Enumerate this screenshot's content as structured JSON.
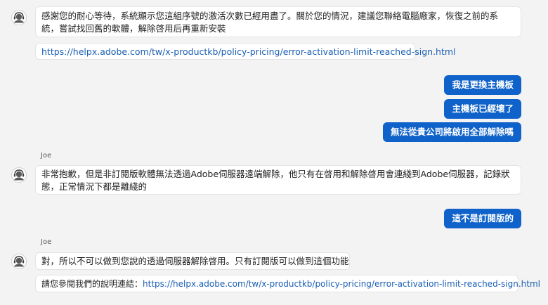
{
  "messages": {
    "m1": {
      "text": "感謝您的耐心等待，系統顯示您這組序號的激活次數已經用盡了。關於您的情況，建議您聯絡電腦廠家，恢復之前的系統，嘗試找回舊的軟體，解除啓用后再重新安裝"
    },
    "m2": {
      "link": "https://helpx.adobe.com/tw/x-productkb/policy-pricing/error-activation-limit-reached-sign.html"
    },
    "u1": {
      "text": "我是更換主機板"
    },
    "u2": {
      "text": "主機板已經壞了"
    },
    "u3": {
      "text": "無法從貴公司將啟用全部解除嗎"
    },
    "agent_name_1": "Joe",
    "m3": {
      "text": "非常抱歉，但是非訂閱版軟體無法透過Adobe伺服器遠端解除，他只有在啓用和解除啓用會連綫到Adobe伺服器，記錄狀態，正常情況下都是離綫的"
    },
    "u4": {
      "text": "這不是訂閱版的"
    },
    "agent_name_2": "Joe",
    "m4": {
      "text": "對，所以不可以做到您說的透過伺服器解除啓用。只有訂閱版可以做到這個功能"
    },
    "m5": {
      "prefix": "請您參閱我們的說明連結：",
      "link": "https://helpx.adobe.com/tw/x-productkb/policy-pricing/error-activation-limit-reached-sign.html"
    }
  },
  "colors": {
    "user_bubble": "#0f62c9",
    "link": "#1a5fb4"
  }
}
